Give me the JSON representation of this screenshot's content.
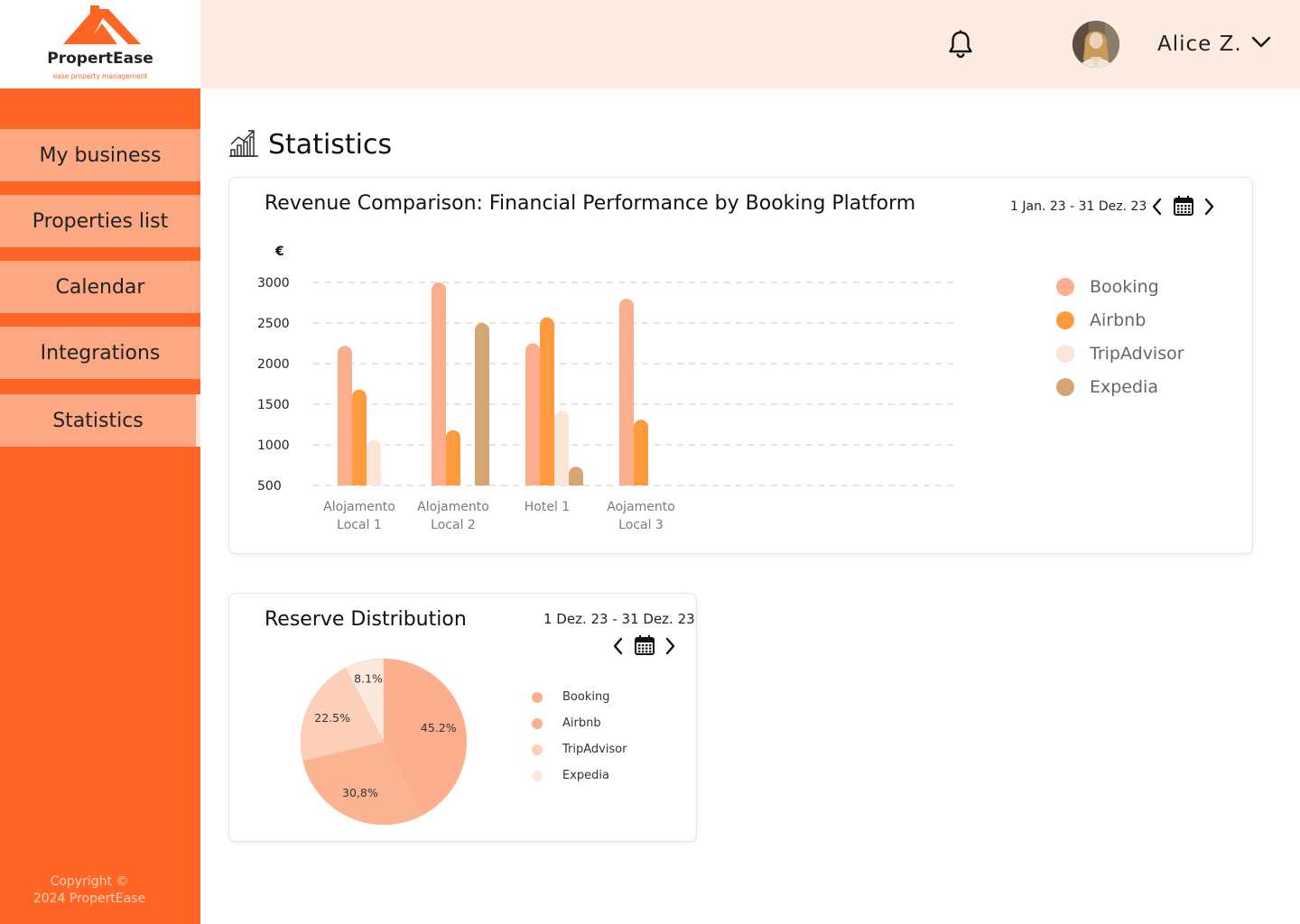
{
  "brand": {
    "name": "PropertEase",
    "tagline": "ease property management"
  },
  "sidebar": {
    "items": [
      {
        "label": "My business"
      },
      {
        "label": "Properties list"
      },
      {
        "label": "Calendar"
      },
      {
        "label": "Integrations"
      },
      {
        "label": "Statistics",
        "active": true
      }
    ],
    "copyright": "Copyright ©\n2024 PropertEase"
  },
  "header": {
    "user_name": "Alice Z."
  },
  "page": {
    "title": "Statistics"
  },
  "colors": {
    "accent": "#ff6524",
    "nav_item": "#fca882",
    "header_bg": "#fdebe2"
  },
  "revenue": {
    "title": "Revenue Comparison: Financial Performance by Booking Platform",
    "date_range": "1 Jan. 23 - 31 Dez. 23"
  },
  "reserve": {
    "title": "Reserve Distribution",
    "date_range": "1 Dez. 23 - 31 Dez. 23"
  },
  "chart_data": [
    {
      "type": "bar",
      "ylabel": "€",
      "yticks": [
        500,
        1000,
        1500,
        2000,
        2500,
        3000
      ],
      "ylim": [
        500,
        3000
      ],
      "grid": true,
      "legend_position": "right",
      "categories": [
        "Alojamento\nLocal 1",
        "Alojamento\nLocal 2",
        "Hotel 1",
        "Aojamento\nLocal 3"
      ],
      "series": [
        {
          "name": "Booking",
          "color": "#fcae8d",
          "values": [
            2220,
            3000,
            2250,
            2800
          ]
        },
        {
          "name": "Airbnb",
          "color": "#ff9a3f",
          "values": [
            1680,
            1180,
            2570,
            1310
          ]
        },
        {
          "name": "TripAdvisor",
          "color": "#fde4d8",
          "values": [
            1060,
            null,
            1420,
            null
          ]
        },
        {
          "name": "Expedia",
          "color": "#d6a575",
          "values": [
            null,
            2500,
            730,
            null
          ]
        }
      ]
    },
    {
      "type": "pie",
      "legend_position": "right",
      "slices": [
        {
          "label": "45.2%",
          "value": 45.2,
          "color": "#fcae8d"
        },
        {
          "label": "30,8%",
          "value": 30.8,
          "color": "#fcb391"
        },
        {
          "label": "22.5%",
          "value": 22.5,
          "color": "#fdcfb9"
        },
        {
          "label": "8.1%",
          "value": 8.1,
          "color": "#fde8de"
        }
      ],
      "legend": [
        {
          "name": "Booking",
          "color": "#fcae8d"
        },
        {
          "name": "Airbnb",
          "color": "#fcae8d"
        },
        {
          "name": "TripAdvisor",
          "color": "#fdcfb9"
        },
        {
          "name": "Expedia",
          "color": "#fde8de"
        }
      ]
    }
  ]
}
